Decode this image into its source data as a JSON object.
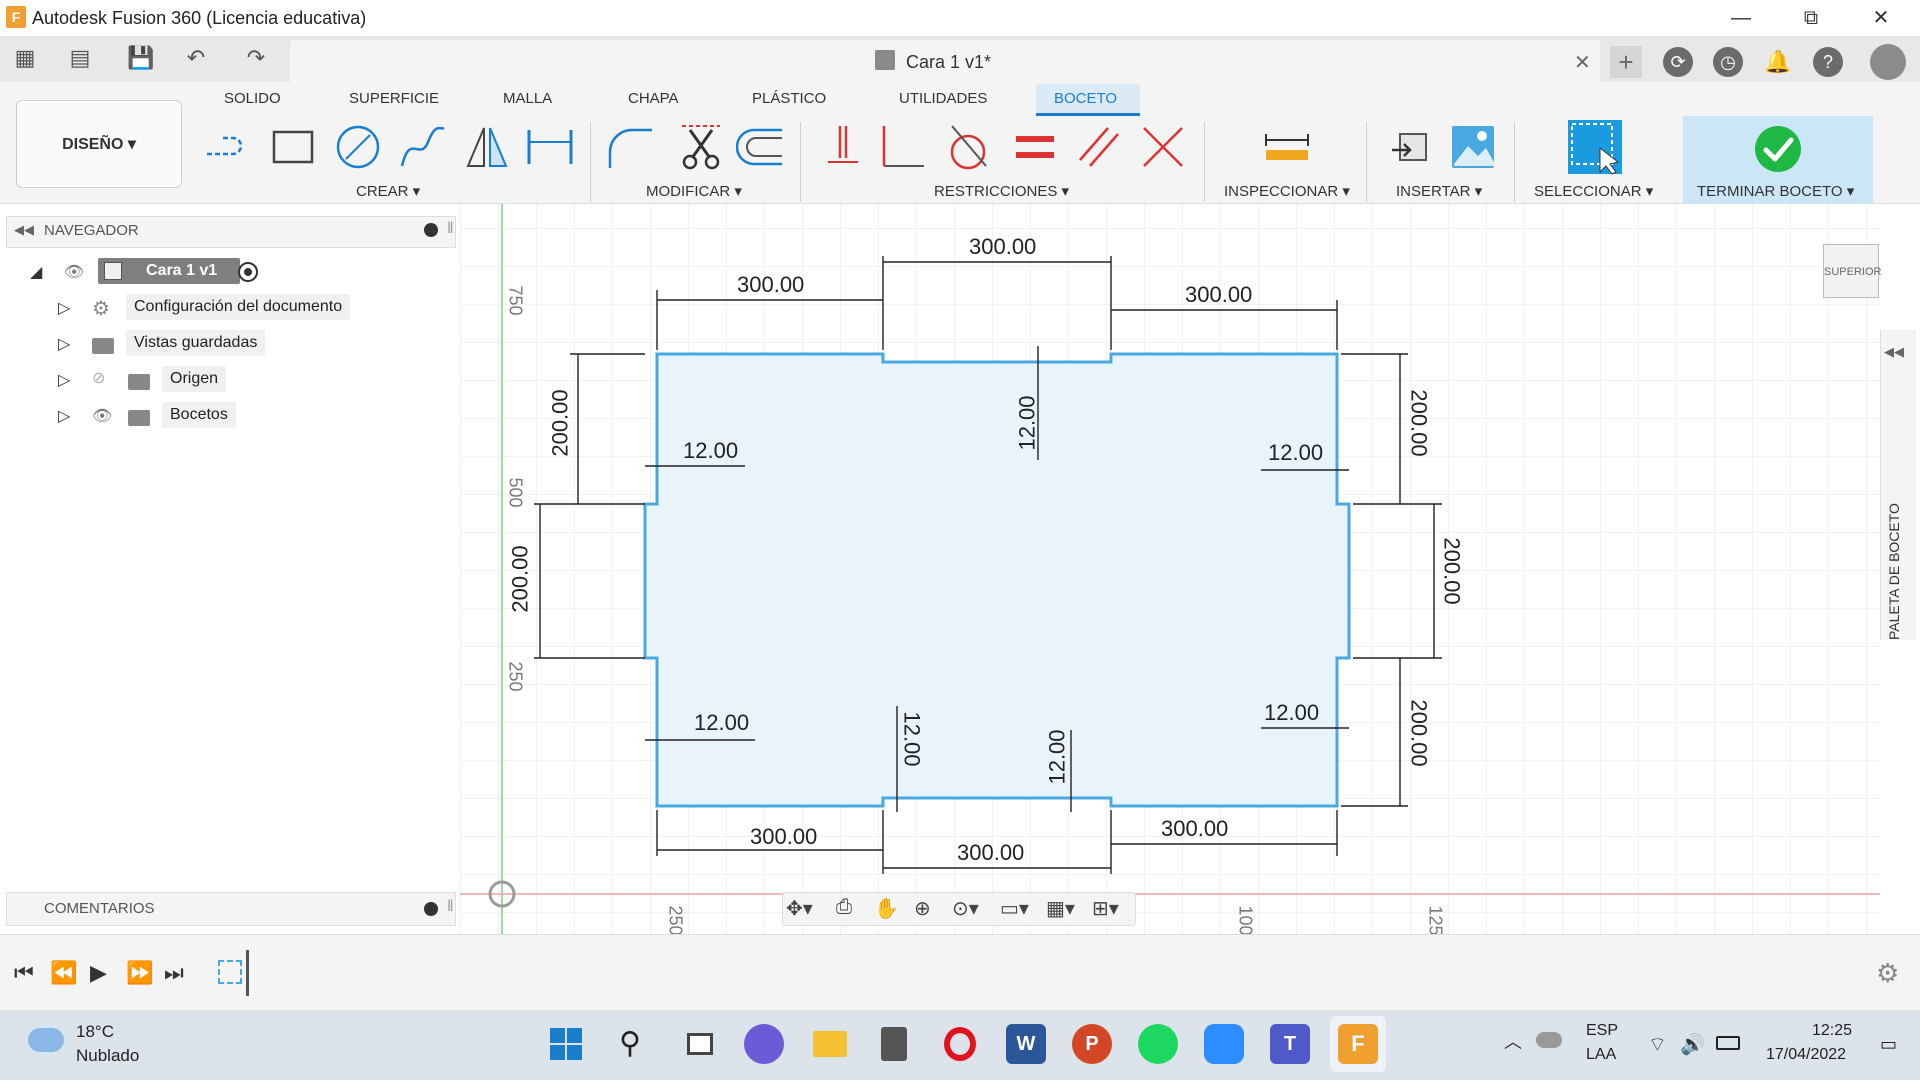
{
  "window": {
    "title": "Autodesk Fusion 360 (Licencia educativa)",
    "logo_letter": "F",
    "minimize": "—",
    "maximize": "⧉",
    "close": "✕"
  },
  "document_tab": {
    "title": "Cara 1 v1*",
    "close": "✕"
  },
  "ribbon": {
    "workspace": "DISEÑO ▾",
    "tabs": [
      "SOLIDO",
      "SUPERFICIE",
      "MALLA",
      "CHAPA",
      "PLÁSTICO",
      "UTILIDADES",
      "BOCETO"
    ],
    "active_tab": "BOCETO",
    "groups": {
      "crear": "CREAR ▾",
      "modificar": "MODIFICAR ▾",
      "restricciones": "RESTRICCIONES ▾",
      "inspeccionar": "INSPECCIONAR ▾",
      "insertar": "INSERTAR ▾",
      "seleccionar": "SELECCIONAR ▾",
      "terminar": "TERMINAR BOCETO ▾"
    }
  },
  "navigator": {
    "title": "NAVEGADOR",
    "root": "Cara 1 v1",
    "items": [
      {
        "label": "Configuración del documento",
        "icon": "gear-icon"
      },
      {
        "label": "Vistas guardadas",
        "icon": "folder-icon"
      },
      {
        "label": "Origen",
        "icon": "folder-icon"
      },
      {
        "label": "Bocetos",
        "icon": "folder-icon"
      }
    ]
  },
  "comments": {
    "title": "COMENTARIOS"
  },
  "canvas": {
    "view_cube_label": "SUPERIOR",
    "palette_label": "PALETA DE BOCETO",
    "ruler_left": [
      "750",
      "500",
      "250"
    ],
    "ruler_bottom": [
      "250",
      "100",
      "125"
    ],
    "dimensions": {
      "top_left": "300.00",
      "top_middle": "300.00",
      "top_right": "300.00",
      "bottom_left": "300.00",
      "bottom_middle": "300.00",
      "bottom_right": "300.00",
      "left_top": "200.00",
      "left_middle": "200.00",
      "right_top": "200.00",
      "right_middle": "200.00",
      "right_bottom": "200.00",
      "notch_left_top": "12.00",
      "notch_left_bottom": "12.00",
      "notch_right_top": "12.00",
      "notch_right_bottom": "12.00",
      "notch_top": "12.00",
      "notch_bottom_left": "12.00",
      "notch_bottom_right": "12.00"
    }
  },
  "taskbar": {
    "weather_temp": "18°C",
    "weather_desc": "Nublado",
    "lang": "ESP",
    "lang2": "LAA",
    "time": "12:25",
    "date": "17/04/2022"
  },
  "colors": {
    "sketch_line": "#4aa8e0",
    "sketch_fill": "#e9f3fb",
    "accent": "#1a7ed0",
    "finish_green": "#1fb844"
  }
}
